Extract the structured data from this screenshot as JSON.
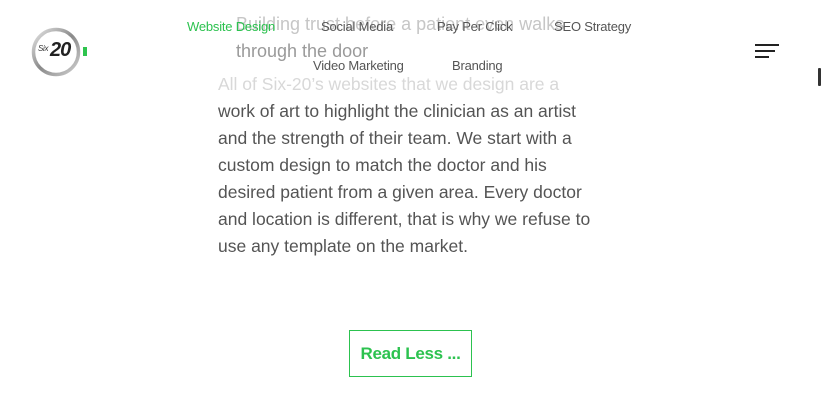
{
  "brand": {
    "logo_small": "Six",
    "logo_big": "20",
    "accent_color": "#2cc24f"
  },
  "heading": {
    "line1": "Building trust before a patient even walks",
    "line2": "through the door"
  },
  "nav": {
    "row1": [
      "Website Design",
      "Social Media",
      "Pay Per Click",
      "SEO Strategy"
    ],
    "row2": [
      "Video Marketing",
      "Branding"
    ],
    "active": "Website Design"
  },
  "menu_icon": "hamburger-menu-icon",
  "content": {
    "lines": [
      "All of Six-20’s websites that we design are a",
      "work of art to highlight the clinician as an artist",
      "and the strength of their team. We start with a",
      "custom design to match the doctor and his",
      "desired patient from a given area. Every doctor",
      "and location is different, that is why we refuse to",
      "use any template on the market."
    ]
  },
  "button": {
    "read_less_label": "Read Less ..."
  }
}
